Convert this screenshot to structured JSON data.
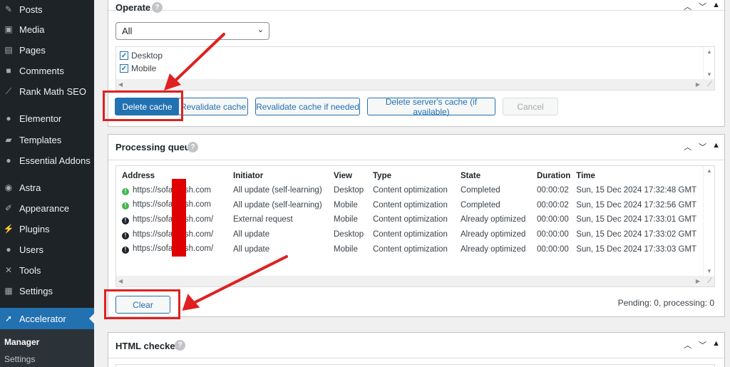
{
  "sidebar": {
    "items": [
      {
        "label": "Posts",
        "icon": "pin-icon"
      },
      {
        "label": "Media",
        "icon": "media-icon"
      },
      {
        "label": "Pages",
        "icon": "pages-icon"
      },
      {
        "label": "Comments",
        "icon": "comments-icon"
      },
      {
        "label": "Rank Math SEO",
        "icon": "chart-icon"
      },
      {
        "label": "Elementor",
        "icon": "elementor-icon"
      },
      {
        "label": "Templates",
        "icon": "folder-icon"
      },
      {
        "label": "Essential Addons",
        "icon": "ea-icon"
      },
      {
        "label": "Astra",
        "icon": "astra-icon"
      },
      {
        "label": "Appearance",
        "icon": "brush-icon"
      },
      {
        "label": "Plugins",
        "icon": "plug-icon"
      },
      {
        "label": "Users",
        "icon": "user-icon"
      },
      {
        "label": "Tools",
        "icon": "wrench-icon"
      },
      {
        "label": "Settings",
        "icon": "settings-icon"
      },
      {
        "label": "Accelerator",
        "icon": "accelerator-icon"
      }
    ],
    "submenu": [
      "Manager",
      "Settings"
    ]
  },
  "operate": {
    "title": "Operate",
    "select_value": "All",
    "checkboxes": [
      "Desktop",
      "Mobile"
    ],
    "buttons": {
      "delete_cache": "Delete cache",
      "revalidate": "Revalidate cache",
      "revalidate_if_needed": "Revalidate cache if needed",
      "delete_server": "Delete server's cache (if available)",
      "cancel": "Cancel"
    }
  },
  "queue": {
    "title": "Processing queue",
    "columns": [
      "Address",
      "Initiator",
      "View",
      "Type",
      "State",
      "Duration",
      "Time"
    ],
    "rows": [
      {
        "status": "ok",
        "address": "https://sofa     lish.com",
        "initiator": "All update (self-learning)",
        "view": "Desktop",
        "type": "Content optimization",
        "state": "Completed",
        "duration": "00:00:02",
        "time": "Sun, 15 Dec 2024 17:32:48 GMT"
      },
      {
        "status": "ok",
        "address": "https://sofa     lish.com",
        "initiator": "All update (self-learning)",
        "view": "Mobile",
        "type": "Content optimization",
        "state": "Completed",
        "duration": "00:00:02",
        "time": "Sun, 15 Dec 2024 17:32:56 GMT"
      },
      {
        "status": "info",
        "address": "https://sofa     lish.com/",
        "initiator": "External request",
        "view": "Mobile",
        "type": "Content optimization",
        "state": "Already optimized",
        "duration": "00:00:00",
        "time": "Sun, 15 Dec 2024 17:33:01 GMT"
      },
      {
        "status": "info",
        "address": "https://sofa     lish.com/",
        "initiator": "All update",
        "view": "Desktop",
        "type": "Content optimization",
        "state": "Already optimized",
        "duration": "00:00:00",
        "time": "Sun, 15 Dec 2024 17:33:02 GMT"
      },
      {
        "status": "info",
        "address": "https://sofa     lish.com/",
        "initiator": "All update",
        "view": "Mobile",
        "type": "Content optimization",
        "state": "Already optimized",
        "duration": "00:00:00",
        "time": "Sun, 15 Dec 2024 17:33:03 GMT"
      }
    ],
    "clear_label": "Clear",
    "status_text": "Pending: 0, processing: 0"
  },
  "html_checker": {
    "title": "HTML checker"
  },
  "colors": {
    "accent": "#2271b1",
    "annotation": "#e02020",
    "ok": "#46b450"
  }
}
